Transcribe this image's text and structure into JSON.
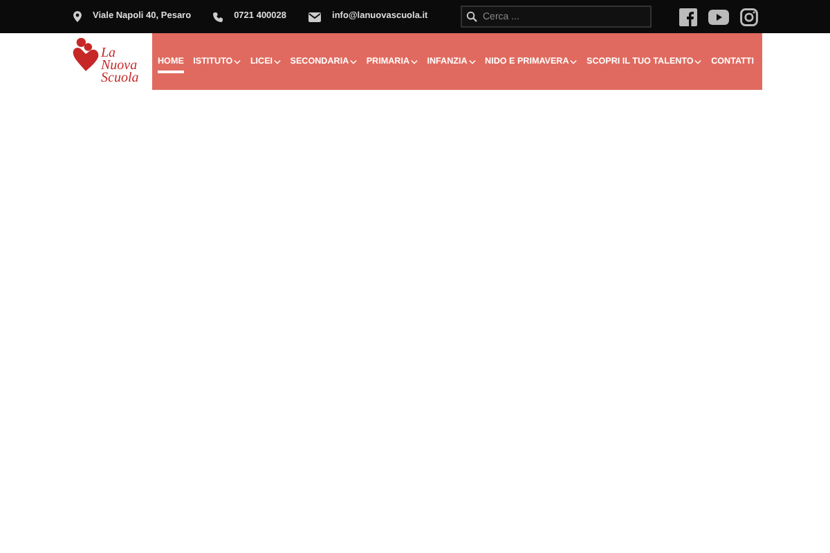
{
  "topbar": {
    "address": "Viale Napoli 40, Pesaro",
    "phone": "0721 400028",
    "email": "info@lanuovascuola.it",
    "search": {
      "placeholder": "Cerca ..."
    }
  },
  "logo": {
    "lines": [
      "La",
      "Nuova",
      "Scuola"
    ]
  },
  "menu": [
    {
      "label": "HOME",
      "selected": true,
      "dropdown": false
    },
    {
      "label": "ISTITUTO",
      "selected": false,
      "dropdown": true
    },
    {
      "label": "LICEI",
      "selected": false,
      "dropdown": true
    },
    {
      "label": "SECONDARIA",
      "selected": false,
      "dropdown": true
    },
    {
      "label": "PRIMARIA",
      "selected": false,
      "dropdown": true
    },
    {
      "label": "INFANZIA",
      "selected": false,
      "dropdown": true
    },
    {
      "label": "NIDO E PRIMAVERA",
      "selected": false,
      "dropdown": true
    },
    {
      "label": "SCOPRI IL TUO TALENTO",
      "selected": false,
      "dropdown": true
    },
    {
      "label": "CONTATTI",
      "selected": false,
      "dropdown": false
    }
  ]
}
